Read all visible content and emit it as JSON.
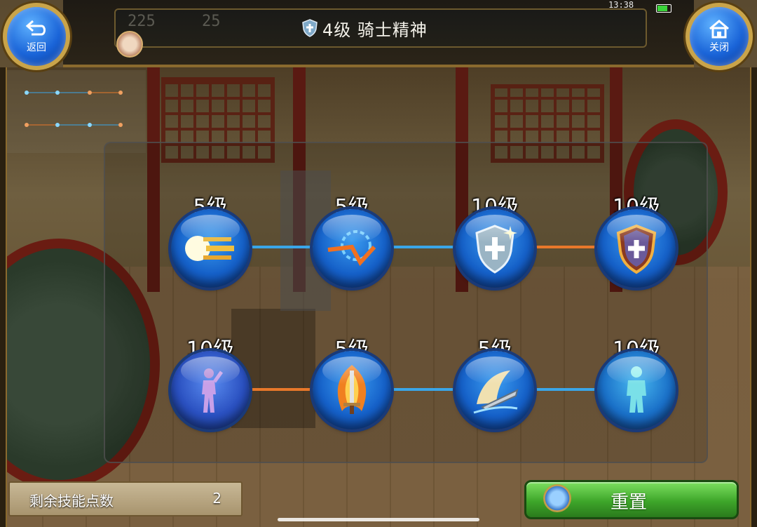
{
  "header": {
    "title": "4级 骑士精神",
    "ghost_stats": [
      "225",
      "25"
    ],
    "clock": "13:38"
  },
  "buttons": {
    "back_label": "返回",
    "close_label": "关闭",
    "reset_label": "重置"
  },
  "skill_rows": [
    {
      "nodes": [
        {
          "level": "5级",
          "icon": "dash-speed-icon"
        },
        {
          "level": "5级",
          "icon": "whirl-slash-icon"
        },
        {
          "level": "10级",
          "icon": "holy-shield-icon"
        },
        {
          "level": "10级",
          "icon": "fire-shield-icon"
        }
      ],
      "links": [
        "blue",
        "blue",
        "orange"
      ]
    },
    {
      "nodes": [
        {
          "level": "10级",
          "icon": "purple-figure-icon"
        },
        {
          "level": "5级",
          "icon": "flame-sword-icon"
        },
        {
          "level": "5级",
          "icon": "wind-blade-icon"
        },
        {
          "level": "10级",
          "icon": "ice-figure-icon"
        }
      ],
      "links": [
        "orange",
        "blue",
        "blue"
      ]
    }
  ],
  "remaining_points": {
    "label": "剩余技能点数",
    "value": "2"
  },
  "colors": {
    "link_blue": "#3aa6e8",
    "link_orange": "#e8782a",
    "reset_green": "#3ea62a",
    "node_blue": "#1560c8"
  }
}
